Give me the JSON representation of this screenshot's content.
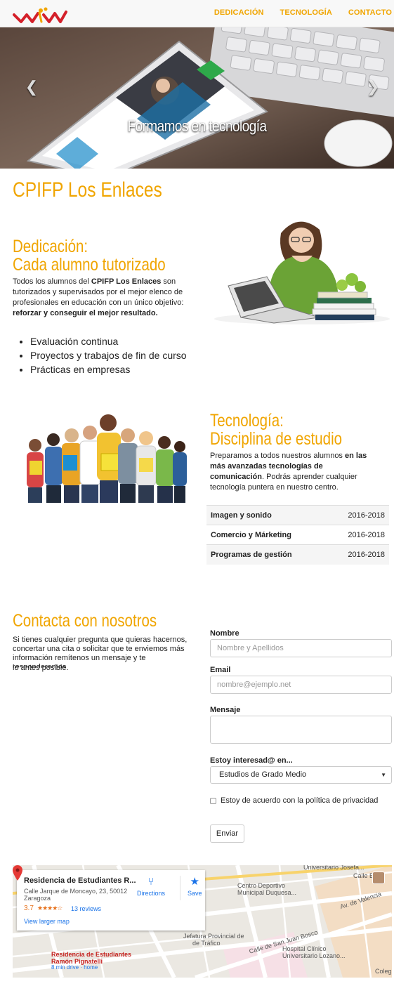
{
  "nav": {
    "links": [
      "DEDICACIÓN",
      "TECNOLOGÍA",
      "CONTACTO"
    ]
  },
  "hero": {
    "caption": "Formamos en tecnología",
    "prev_icon": "chevron-left-icon",
    "next_icon": "chevron-right-icon",
    "prev_glyph": "❮",
    "next_glyph": "❯"
  },
  "page_title": "CPIFP Los Enlaces",
  "dedicacion": {
    "title_line1": "Dedicación:",
    "title_line2": "Cada alumno tutorizado",
    "text_a": "Todos los alumnos del ",
    "text_b": "CPIFP Los Enlaces",
    "text_c": " son tutorizados y supervisados por el mejor elenco de profesionales en educación con un único objetivo: ",
    "text_d": "reforzar y conseguir el mejor resultado.",
    "bullets": [
      "Evaluación continua",
      "Proyectos y trabajos de fin de curso",
      "Prácticas en empresas"
    ]
  },
  "tecnologia": {
    "title_line1": "Tecnología:",
    "title_line2": "Disciplina de estudio",
    "text_a": "Preparamos a todos nuestros alumnos ",
    "text_b": "en las más avanzadas tecnologías de comunicación",
    "text_c": ". Podrás aprender cualquier tecnología puntera en nuestro centro.",
    "courses": [
      {
        "name": "Imagen y sonido",
        "years": "2016-2018"
      },
      {
        "name": "Comercio y Márketing",
        "years": "2016-2018"
      },
      {
        "name": "Programas de gestión",
        "years": "2016-2018"
      }
    ]
  },
  "contacto": {
    "title": "Contacta con nosotros",
    "text": "Si tienes cualquier pregunta que quieras hacernos, concertar una cita o solicitar que te enviemos más información remítenos un mensaje y te responderemos",
    "text_end": "lo antes posible.",
    "form": {
      "name_label": "Nombre",
      "name_placeholder": "Nombre y Apellidos",
      "email_label": "Email",
      "email_placeholder": "nombre@ejemplo.net",
      "message_label": "Mensaje",
      "interest_label": "Estoy interesad@ en...",
      "interest_value": "Estudios de Grado Medio",
      "privacy_label": "Estoy de acuerdo con la política de privacidad",
      "submit_label": "Enviar"
    }
  },
  "map": {
    "place_name": "Residencia de Estudiantes R...",
    "address": "Calle Jarque de Moncayo, 23, 50012 Zaragoza",
    "rating": "3.7",
    "stars": "★★★★☆",
    "reviews": "13 reviews",
    "larger_map": "View larger map",
    "directions": "Directions",
    "save": "Save",
    "pin_title_1": "Residencia de Estudiantes",
    "pin_title_2": "Ramón Pignatelli",
    "pin_sub": "8 min drive · home",
    "labels": [
      "Universitario Josefa...",
      "Centro Deportivo",
      "Municipal Duquesa...",
      "Av. de Valencia",
      "Jefatura Provincial de",
      "de Tráfico",
      "Calle de San Juan Bosco",
      "Hospital Clínico",
      "Universitario Lozano...",
      "Coleg",
      "Calle Bi"
    ]
  }
}
